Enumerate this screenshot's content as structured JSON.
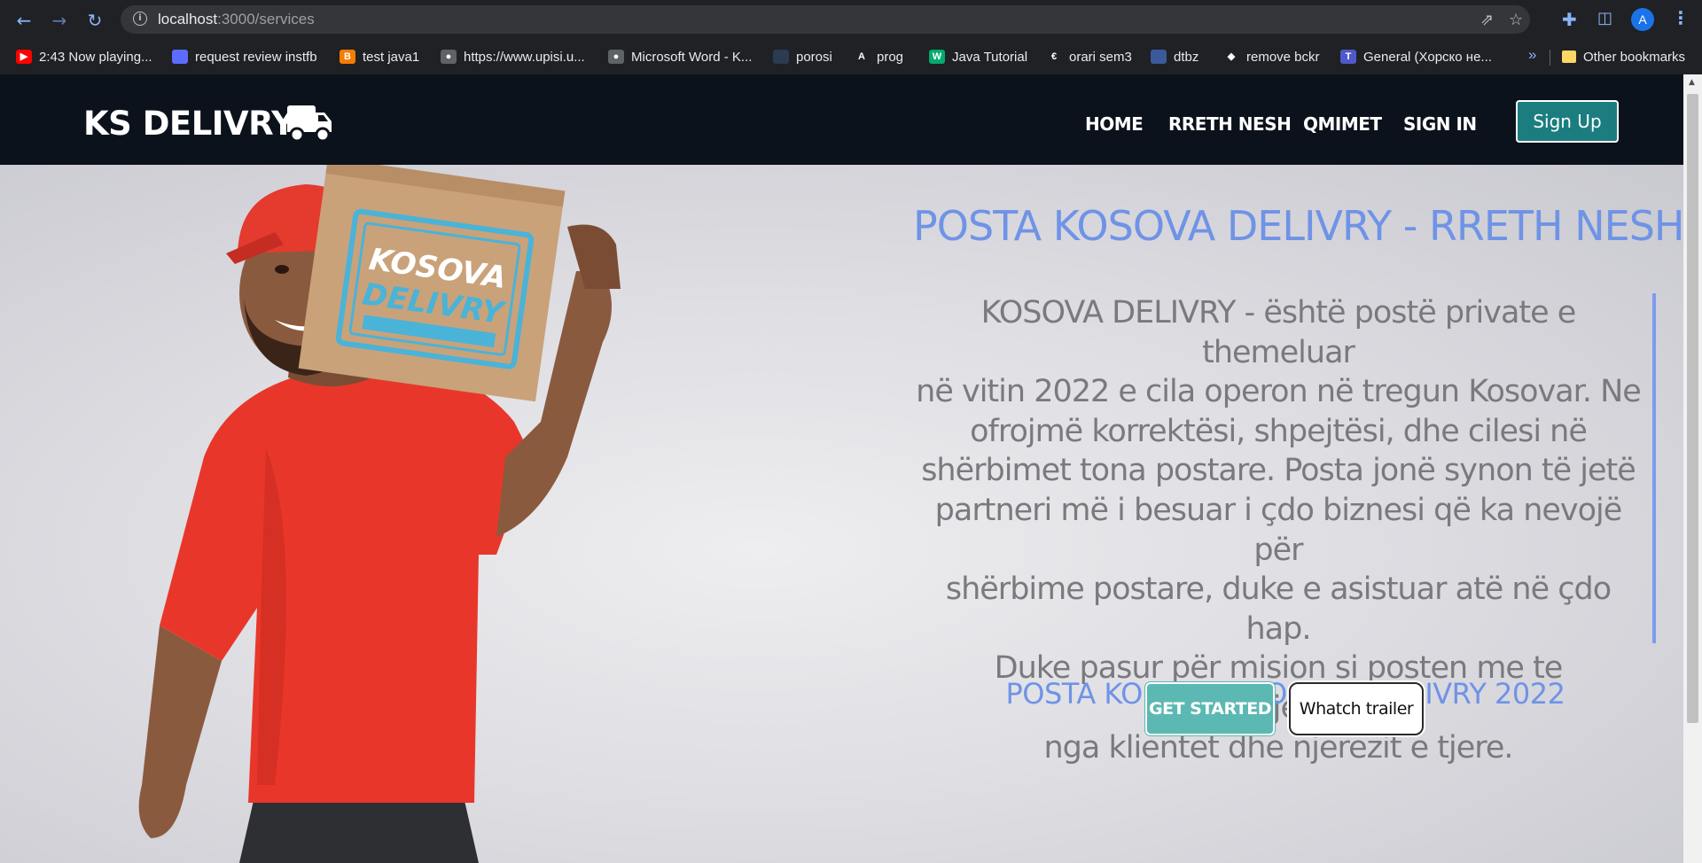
{
  "browser": {
    "url_host": "localhost",
    "url_rest": ":3000/services",
    "profile_initial": "A",
    "bookmarks": [
      {
        "label": "2:43 Now playing...",
        "icon": "youtube-icon",
        "color": "#ff0000"
      },
      {
        "label": "request review instfb",
        "icon": "site-icon",
        "color": "#5b6cff"
      },
      {
        "label": "test java1",
        "icon": "blogger-icon",
        "color": "#f57d00"
      },
      {
        "label": "https://www.upisi.u...",
        "icon": "globe-icon",
        "color": "#5f6368"
      },
      {
        "label": "Microsoft Word - K...",
        "icon": "globe-icon",
        "color": "#5f6368"
      },
      {
        "label": "porosi",
        "icon": "site-icon",
        "color": "#2b3b52"
      },
      {
        "label": "prog",
        "icon": "angular-icon",
        "color": "#202124"
      },
      {
        "label": "Java Tutorial",
        "icon": "w3schools-icon",
        "color": "#04aa6d"
      },
      {
        "label": "orari sem3",
        "icon": "es-icon",
        "color": "#202124"
      },
      {
        "label": "dtbz",
        "icon": "site-icon",
        "color": "#3a5a9c"
      },
      {
        "label": "remove bckr",
        "icon": "layers-icon",
        "color": "#202124"
      },
      {
        "label": "General (Хорско не...",
        "icon": "teams-icon",
        "color": "#5059c9"
      }
    ],
    "other_bookmarks": "Other bookmarks",
    "more": "»"
  },
  "navbar": {
    "brand": "KS DELIVRY",
    "links": [
      "HOME",
      "RRETH NESH",
      "QMIMET",
      "SIGN IN"
    ],
    "signup_label": "Sign Up"
  },
  "hero": {
    "title": "POSTA KOSOVA DELIVRY - RRETH NESH",
    "paragraph_lines": [
      "KOSOVA DELIVRY - është postë private e themeluar",
      "në vitin 2022 e cila operon në tregun Kosovar. Ne",
      "ofrojmë korrektësi, shpejtësi, dhe cilesi në",
      "shërbimet tona postare. Posta jonë synon të jetë",
      "partneri më i besuar i çdo biznesi që ka nevojë për",
      "shërbime postare, duke e asistuar atë në çdo hap.",
      "Duke pasur për mision si posten me te përzgjedhur",
      "nga klientet dhe njerezit e tjere."
    ],
    "subtitle": "POSTA KOSOVA – KOSOVA DELIVRY 2022",
    "btn_get_started": "GET STARTED",
    "btn_trailer": "Whatch trailer",
    "box_text_1": "KOSOVA",
    "box_text_2": "DELIVRY"
  }
}
